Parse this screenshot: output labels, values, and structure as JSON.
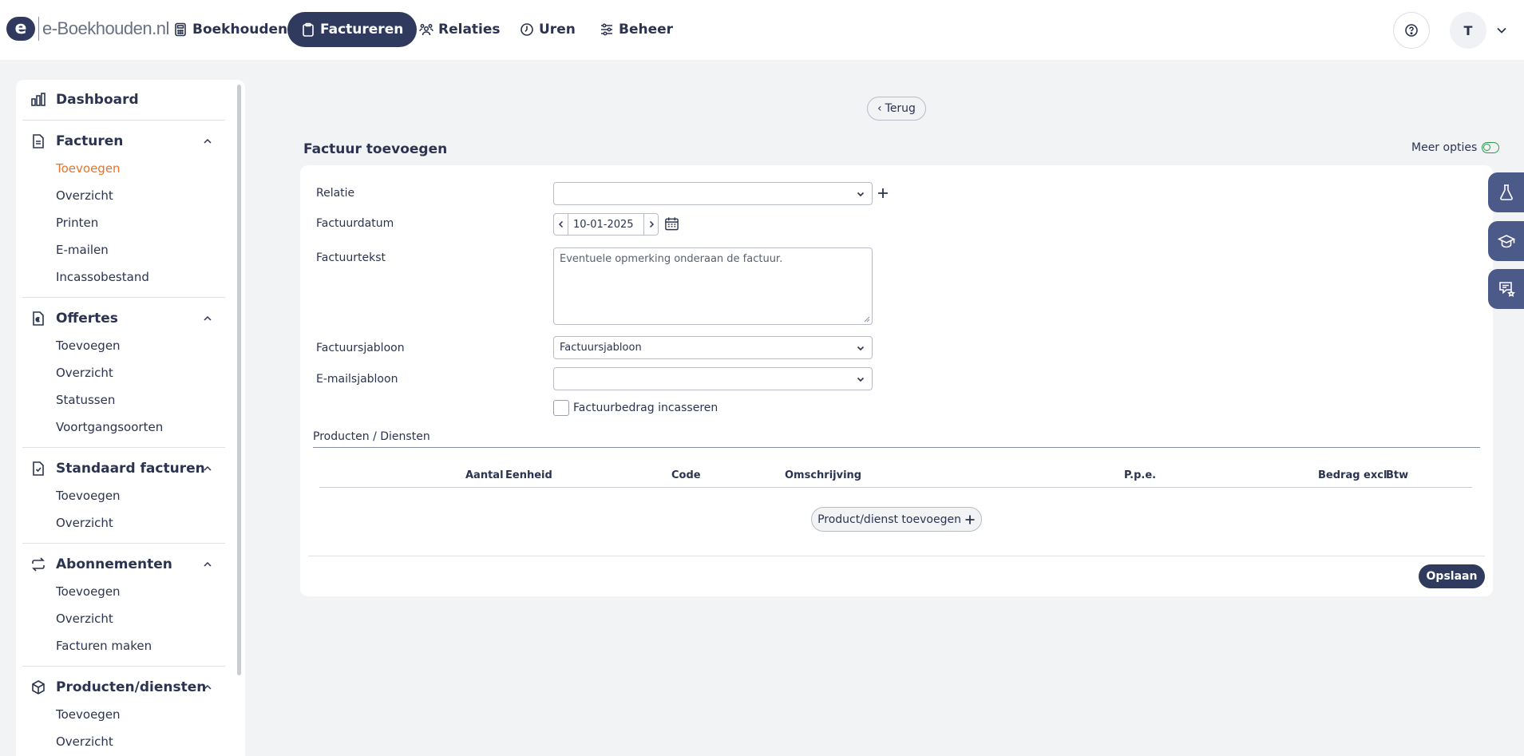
{
  "topbar": {
    "logo_mark": "e",
    "logo_text": "e-Boekhouden.nl",
    "nav": [
      {
        "label": "Boekhouden",
        "icon": "calculator-icon"
      },
      {
        "label": "Factureren",
        "icon": "clipboard-icon",
        "active": true
      },
      {
        "label": "Relaties",
        "icon": "users-icon"
      },
      {
        "label": "Uren",
        "icon": "clock-icon"
      },
      {
        "label": "Beheer",
        "icon": "sliders-icon"
      }
    ],
    "help_icon": "question-circle-icon",
    "avatar_initial": "T"
  },
  "sidebar": {
    "dashboard": "Dashboard",
    "groups": [
      {
        "title": "Facturen",
        "items": [
          "Toevoegen",
          "Overzicht",
          "Printen",
          "E-mailen",
          "Incassobestand"
        ],
        "current": "Toevoegen"
      },
      {
        "title": "Offertes",
        "items": [
          "Toevoegen",
          "Overzicht",
          "Statussen",
          "Voortgangsoorten"
        ]
      },
      {
        "title": "Standaard facturen",
        "items": [
          "Toevoegen",
          "Overzicht"
        ]
      },
      {
        "title": "Abonnementen",
        "items": [
          "Toevoegen",
          "Overzicht",
          "Facturen maken"
        ]
      },
      {
        "title": "Producten/diensten",
        "items": [
          "Toevoegen",
          "Overzicht"
        ]
      }
    ]
  },
  "main": {
    "back_label": "Terug",
    "title": "Factuur toevoegen",
    "more_options": "Meer opties",
    "form": {
      "relatie_label": "Relatie",
      "relatie_value": "",
      "factuurdatum_label": "Factuurdatum",
      "factuurdatum_value": "10-01-2025",
      "factuurtekst_label": "Factuurtekst",
      "factuurtekst_placeholder": "Eventuele opmerking onderaan de factuur.",
      "factuursjabloon_label": "Factuursjabloon",
      "factuursjabloon_value": "Factuursjabloon",
      "emailsjabloon_label": "E-mailsjabloon",
      "emailsjabloon_value": "",
      "incasseren_label": "Factuurbedrag incasseren",
      "incasseren_checked": false
    },
    "products": {
      "section_label": "Producten / Diensten",
      "columns": [
        "Aantal",
        "Eenheid",
        "Code",
        "Omschrijving",
        "P.p.e.",
        "Bedrag excl",
        "Btw"
      ],
      "add_label": "Product/dienst toevoegen"
    },
    "save_label": "Opslaan"
  },
  "side_tabs": [
    "flask-icon",
    "graduation-cap-icon",
    "feedback-icon"
  ],
  "colors": {
    "primary": "#2f3a5e",
    "accent": "#e8732a",
    "toggle": "#2f9a4a",
    "side_tab": "#4c5a8a"
  }
}
